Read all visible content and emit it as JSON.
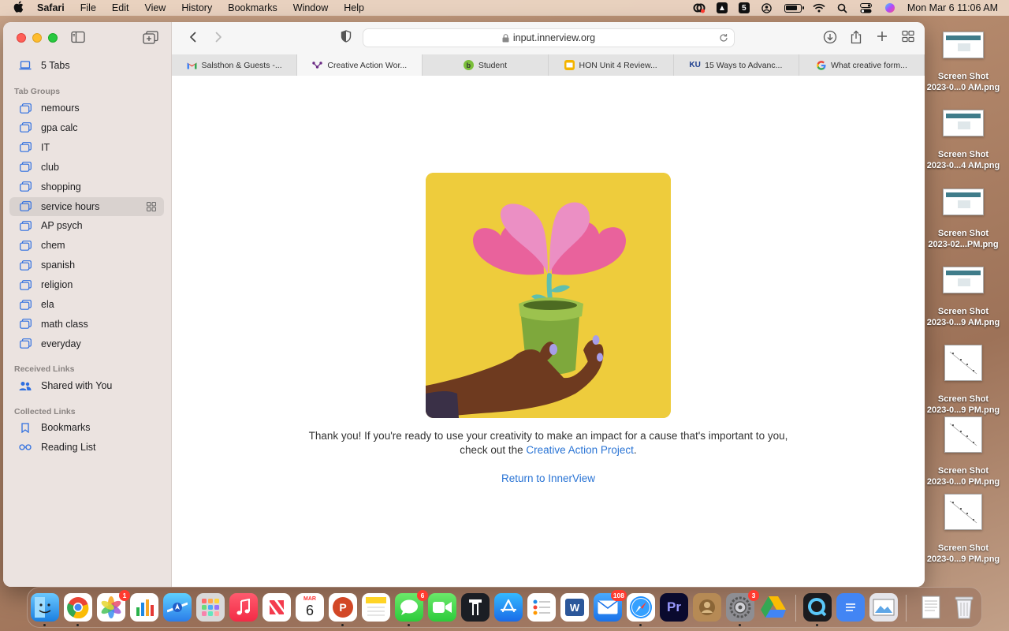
{
  "menubar": {
    "app": "Safari",
    "items": [
      "File",
      "Edit",
      "View",
      "History",
      "Bookmarks",
      "Window",
      "Help"
    ],
    "clock": "Mon Mar 6  11:06 AM",
    "status_icons": [
      "creative-cloud-icon",
      "notion-icon",
      "five-icon",
      "user-icon",
      "battery-icon",
      "wifi-icon",
      "search-icon",
      "control-center-icon",
      "siri-icon"
    ],
    "five_badge": "5"
  },
  "sidebar": {
    "tabs_label": "5 Tabs",
    "groups_header": "Tab Groups",
    "groups": [
      "nemours",
      "gpa calc",
      "IT",
      "club",
      "shopping",
      "service hours",
      "AP psych",
      "chem",
      "spanish",
      "religion",
      "ela",
      "math class",
      "everyday"
    ],
    "selected_group": "service hours",
    "received_header": "Received Links",
    "shared_label": "Shared with You",
    "collected_header": "Collected Links",
    "bookmarks_label": "Bookmarks",
    "reading_list_label": "Reading List"
  },
  "toolbar": {
    "address": "input.innerview.org"
  },
  "tabs": [
    {
      "label": "Salsthon & Guests -...",
      "favicon": "gmail-icon"
    },
    {
      "label": "Creative Action Wor...",
      "favicon": "innerview-icon"
    },
    {
      "label": "Student",
      "favicon": "student-icon"
    },
    {
      "label": "HON Unit 4 Review...",
      "favicon": "slides-icon"
    },
    {
      "label": "15 Ways to Advanc...",
      "favicon": "ku-icon"
    },
    {
      "label": "What creative form...",
      "favicon": "google-icon"
    }
  ],
  "page": {
    "message_prefix": "Thank you! If you're ready to use your creativity to make an impact for a cause that's important to you, check out the ",
    "message_link": "Creative Action Project",
    "message_suffix": ".",
    "return_link": "Return to InnerView"
  },
  "desktop": [
    {
      "line1": "Screen Shot",
      "line2": "2023-0...0 AM.png"
    },
    {
      "line1": "Screen Shot",
      "line2": "2023-0...4 AM.png"
    },
    {
      "line1": "Screen Shot",
      "line2": "2023-02...PM.png"
    },
    {
      "line1": "Screen Shot",
      "line2": "2023-0...9 AM.png"
    },
    {
      "line1": "Screen Shot",
      "line2": "2023-0...9 PM.png"
    },
    {
      "line1": "Screen Shot",
      "line2": "2023-0...0 PM.png"
    },
    {
      "line1": "Screen Shot",
      "line2": "2023-0...9 PM.png"
    }
  ],
  "dock": {
    "photos_badge": "1",
    "calendar_month": "MAR",
    "calendar_day": "6",
    "messages_badge": "6",
    "mail_badge": "108",
    "settings_badge": "3",
    "word_label": "W",
    "premiere_label": "Pr",
    "powerpoint_label": "P"
  }
}
